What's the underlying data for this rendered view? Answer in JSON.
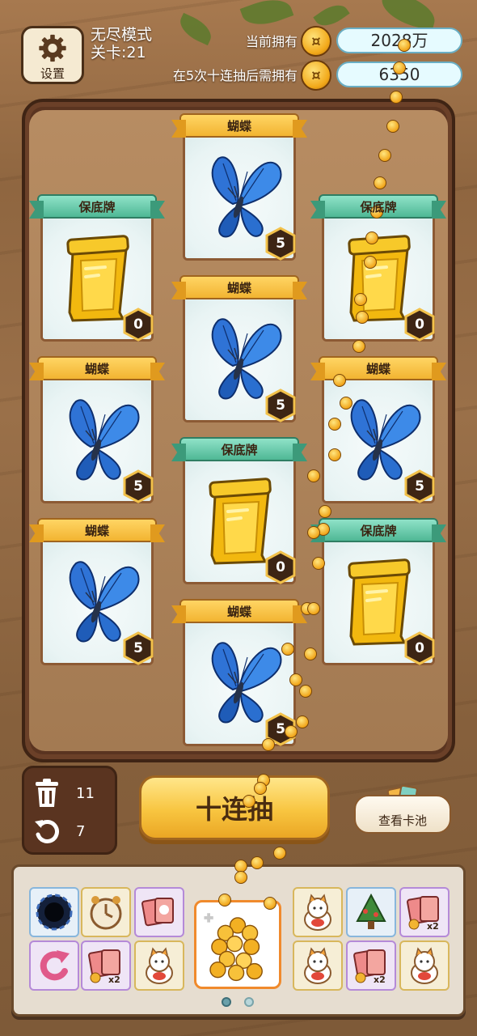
{
  "header": {
    "settings_label": "设置",
    "mode_label": "无尽模式",
    "level_label": "关卡:21",
    "current_label": "当前拥有",
    "current_value": "2028万",
    "need_label": "在5次十连抽后需拥有",
    "need_value": "6350"
  },
  "cards": [
    {
      "name": "蝴蝶",
      "type": "butterfly",
      "count": "5"
    },
    {
      "name": "保底牌",
      "type": "guarantee",
      "count": "0"
    },
    {
      "name": "保底牌",
      "type": "guarantee",
      "count": "0"
    },
    {
      "name": "蝴蝶",
      "type": "butterfly",
      "count": "5"
    },
    {
      "name": "蝴蝶",
      "type": "butterfly",
      "count": "5"
    },
    {
      "name": "蝴蝶",
      "type": "butterfly",
      "count": "5"
    },
    {
      "name": "保底牌",
      "type": "guarantee",
      "count": "0"
    },
    {
      "name": "蝴蝶",
      "type": "butterfly",
      "count": "5"
    },
    {
      "name": "保底牌",
      "type": "guarantee",
      "count": "0"
    },
    {
      "name": "蝴蝶",
      "type": "butterfly",
      "count": "5"
    }
  ],
  "controls": {
    "trash_count": "11",
    "undo_count": "7",
    "draw_label": "十连抽",
    "pool_label": "查看卡池"
  },
  "inventory": {
    "row1": [
      "black-hole-icon",
      "clock-icon",
      "card-pack-icon",
      "hidden",
      "hidden",
      "lucky-cat-icon",
      "tree-icon",
      "card-pack-x2-icon"
    ],
    "row2": [
      "undo-arrow-icon",
      "card-pack-x2-icon",
      "lucky-cat-icon",
      "hidden",
      "hidden",
      "lucky-cat-icon",
      "card-pack-x2-icon",
      "lucky-cat-icon"
    ],
    "selected": "coin-pile-icon"
  },
  "colors": {
    "gold_ribbon": "#f2b431",
    "teal_ribbon": "#4fb895",
    "board": "#5a3420",
    "accent": "#f08a2c"
  }
}
